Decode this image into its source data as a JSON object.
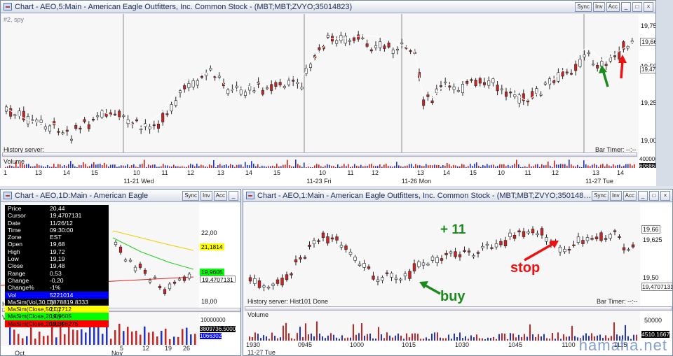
{
  "top": {
    "title": "Chart - AEO,5:Main - American Eagle Outfitters, Inc. Common Stock - (MBT;MBT;ZVYO;35014823)",
    "buttons": [
      "Sync",
      "Inv",
      "Acc"
    ],
    "symbol_overlay": "#2, spy",
    "price_ticks": [
      "19,75",
      "19,50",
      "19,25",
      "19,00"
    ],
    "last_price": "19,66",
    "cursor_price": "19,4707131",
    "history_label": "History server:",
    "bar_timer": "Bar Timer: --:--",
    "volume_label": "Volume",
    "volume_ticks": [
      "400000"
    ],
    "volume_value": "60686.6333",
    "time_ticks": [
      "13",
      "14",
      "15",
      "10",
      "11",
      "12",
      "13",
      "14",
      "15",
      "10",
      "11",
      "12",
      "13",
      "14",
      "15",
      "10",
      "11",
      "12",
      "13",
      "14",
      "15",
      "10",
      "11"
    ],
    "day_labels": [
      "11-21 Wed",
      "11-23 Fri",
      "11-26 Mon",
      "11-27 Tue"
    ],
    "first_tick": "1"
  },
  "daily": {
    "title": "Chart - AEO,1D:Main - American Eagle",
    "buttons": [
      "Sync",
      "Inv",
      "Acc"
    ],
    "price_ticks": [
      "22,00",
      "18,00"
    ],
    "tags": [
      {
        "text": "21,1814",
        "bg": "#ffff00"
      },
      {
        "text": "19,9605",
        "bg": "#00ff00"
      },
      {
        "text": "19,4707131",
        "bg": "#ffffff"
      }
    ],
    "vol_ticks": [
      "10000000"
    ],
    "vol_value": "3809736.5000",
    "vol_value2": "1066302",
    "date_ticks": [
      "5",
      "12",
      "19",
      "26"
    ],
    "month_labels": [
      "Oct",
      "Nov"
    ],
    "history_label": "His",
    "vol_label": "Vo",
    "info": [
      {
        "k": "Price",
        "v": "20,44",
        "bg": "#000000",
        "fg": "#ffffff"
      },
      {
        "k": "Cursor",
        "v": "19,4707131",
        "bg": "#000000",
        "fg": "#ffffff"
      },
      {
        "k": "Date",
        "v": "11/26/12",
        "bg": "#000000",
        "fg": "#ffffff"
      },
      {
        "k": "Time",
        "v": "09:30:00",
        "bg": "#000000",
        "fg": "#ffffff"
      },
      {
        "k": "Zone",
        "v": "EST",
        "bg": "#000000",
        "fg": "#ffffff"
      },
      {
        "k": "Open",
        "v": "19,68",
        "bg": "#000000",
        "fg": "#ffffff"
      },
      {
        "k": "High",
        "v": "19,72",
        "bg": "#000000",
        "fg": "#ffffff"
      },
      {
        "k": "Low",
        "v": "19,19",
        "bg": "#000000",
        "fg": "#ffffff"
      },
      {
        "k": "Close",
        "v": "19,48",
        "bg": "#000000",
        "fg": "#ffffff"
      },
      {
        "k": "Range",
        "v": "0,53",
        "bg": "#000000",
        "fg": "#ffffff"
      },
      {
        "k": "Change",
        "v": "-0,20",
        "bg": "#000000",
        "fg": "#ffffff"
      },
      {
        "k": "Change%",
        "v": "-1%",
        "bg": "#000000",
        "fg": "#ffffff"
      },
      {
        "k": "Vol",
        "v": "5221014",
        "bg": "#0000ff",
        "fg": "#ffffff"
      },
      {
        "k": "MaSim(Vol,30,D)",
        "v": "3878819.8333",
        "bg": "#000000",
        "fg": "#ffffff"
      },
      {
        "k": "MaSim(Close,50,D)",
        "v": "21,2712",
        "bg": "#ffff00",
        "fg": "#000000"
      },
      {
        "k": "MaSim(Close,20,D)",
        "v": "19,9605",
        "bg": "#00ff00",
        "fg": "#000000"
      },
      {
        "k": "MaSim(Close,200,D)",
        "v": "19,396275",
        "bg": "#ff0000",
        "fg": "#000000"
      }
    ]
  },
  "minute": {
    "title": "Chart - AEO,1:Main - American Eagle Outfitters, Inc. Common Stock - (MBT;MBT;ZVYO;35014823)",
    "buttons": [
      "Sync",
      "Inv",
      "Acc"
    ],
    "price_ticks": [
      "19,625",
      "19,50"
    ],
    "last_price": "19,66",
    "cursor_price": "19,4707131",
    "history_label": "History server: Hist101 Done",
    "bar_timer": "Bar Timer: --:--",
    "volume_label": "Volume",
    "vol_ticks": [
      "50000"
    ],
    "vol_value": "4510.1667",
    "time_ticks": [
      "1930",
      "0945",
      "1000",
      "1015",
      "1030",
      "1045",
      "1100",
      "1115"
    ],
    "day_label": "11-27 Tue"
  },
  "annotations": {
    "plus": "+ 11",
    "buy": "buy",
    "stop": "stop"
  },
  "watermark": "hamaha.net",
  "colors": {
    "up": "#ffffff",
    "down": "#cc2222",
    "arrow_green": "#1d8a1d",
    "arrow_red": "#ee1111"
  }
}
